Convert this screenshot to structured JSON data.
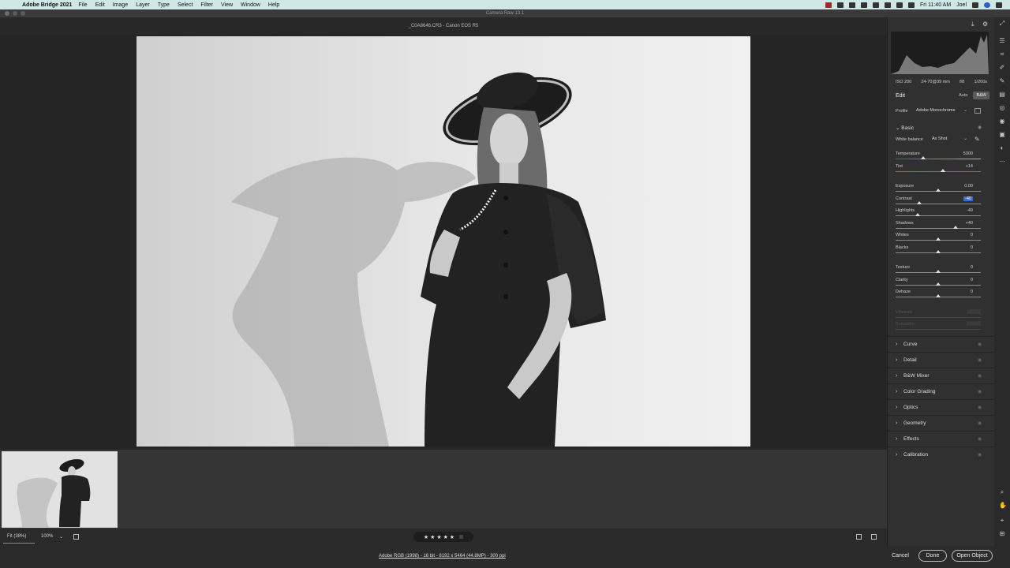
{
  "menubar": {
    "app_name": "Adobe Bridge 2021",
    "menus": [
      "File",
      "Edit",
      "Image",
      "Layer",
      "Type",
      "Select",
      "Filter",
      "View",
      "Window",
      "Help"
    ],
    "clock": "Fri 11:40 AM",
    "user": "Joel"
  },
  "window": {
    "title": "Camera Raw 13.1"
  },
  "file": {
    "header": "_C0A8646.CR3  -  Canon EOS R5"
  },
  "exif": {
    "iso": "ISO 200",
    "lens": "24-70@39 mm",
    "aperture": "f/8",
    "shutter": "1/200s"
  },
  "edit": {
    "title": "Edit",
    "auto_label": "Auto",
    "bw_label": "B&W",
    "profile_label": "Profile",
    "profile_value": "Adobe Monochrome"
  },
  "basic": {
    "title": "Basic",
    "wb_label": "White balance",
    "wb_value": "As Shot",
    "sliders": [
      {
        "label": "Temperature",
        "value": "5300",
        "pos": 0.32
      },
      {
        "label": "Tint",
        "value": "+14",
        "pos": 0.56
      },
      {
        "label": "Exposure",
        "value": "0.00",
        "pos": 0.5
      },
      {
        "label": "Contrast",
        "value": "-40",
        "pos": 0.28
      },
      {
        "label": "Highlights",
        "value": "-49",
        "pos": 0.255
      },
      {
        "label": "Shadows",
        "value": "+40",
        "pos": 0.7
      },
      {
        "label": "Whites",
        "value": "0",
        "pos": 0.5
      },
      {
        "label": "Blacks",
        "value": "0",
        "pos": 0.5
      },
      {
        "label": "Texture",
        "value": "0",
        "pos": 0.5
      },
      {
        "label": "Clarity",
        "value": "0",
        "pos": 0.5
      },
      {
        "label": "Dehaze",
        "value": "0",
        "pos": 0.5
      },
      {
        "label": "Vibrance",
        "value": "",
        "pos": 0.5
      },
      {
        "label": "Saturation",
        "value": "",
        "pos": 0.5
      }
    ]
  },
  "panels": [
    "Curve",
    "Detail",
    "B&W Mixer",
    "Color Grading",
    "Optics",
    "Geometry",
    "Effects",
    "Calibration"
  ],
  "bottom": {
    "fit_label": "Fit (38%)",
    "zoom_label": "100%",
    "stars": "★ ★ ★ ★ ★"
  },
  "footer": {
    "workflow": "Adobe RGB (1998) - 16 bit - 8192 x 5464 (44.8MP) - 300 ppi",
    "cancel": "Cancel",
    "done": "Done",
    "open": "Open Object"
  },
  "icons": {
    "tools": [
      "edit-icon",
      "crop-icon",
      "brush-icon",
      "gradient-icon",
      "radial-icon",
      "redeye-icon",
      "snapshot-icon",
      "presets-icon",
      "more-icon",
      "zoom-icon",
      "hand-icon",
      "sampler-icon",
      "grid-icon"
    ]
  }
}
